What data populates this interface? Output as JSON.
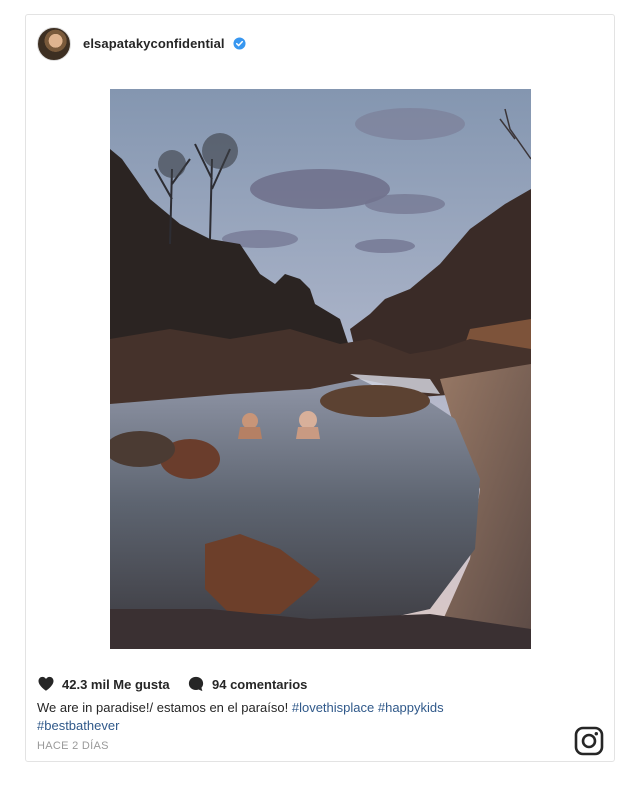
{
  "post": {
    "username": "elsapatakyconfidential",
    "verified_icon": "verified-badge-icon",
    "likes": "42.3 mil Me gusta",
    "comments": "94 comentarios",
    "caption_text": "We are in paradise!/ estamos en el paraíso! ",
    "hashtags": [
      "#lovethisplace",
      "#happykids",
      "#bestbathever"
    ],
    "time": "HACE 2 DÍAS"
  },
  "icons": {
    "heart": "heart-icon",
    "comment": "comment-bubble-icon",
    "instagram": "instagram-logo-icon",
    "avatar": "avatar"
  },
  "colors": {
    "hashtag": "#30598a",
    "verified": "#3897f0",
    "muted": "#999999",
    "text": "#262626",
    "border": "#e3e3e3"
  }
}
